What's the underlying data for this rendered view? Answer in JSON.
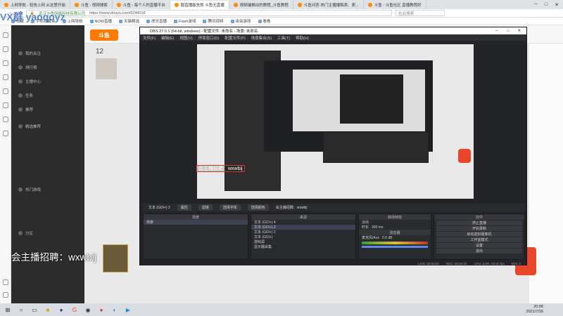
{
  "browser": {
    "tabs": [
      {
        "label": "上网导航 - 轻快上网 从这里开始"
      },
      {
        "label": "斗鱼 - 视频搜索"
      },
      {
        "label": "斗鱼 - 每个人的直播平台"
      },
      {
        "label": "服直播能失败 斗鱼无直播"
      },
      {
        "label": "视频端推出的教程_斗鱼教程"
      },
      {
        "label": "斗鱼问答-热门主播播稿类、更..."
      },
      {
        "label": "斗鱼 - 斗鱼社区 直播教程好"
      }
    ],
    "company": "武汉斗鱼网络科技有限公司",
    "url": "https://www.douyu.com/5244018",
    "search_placeholder": "在此搜索",
    "bookmarks": [
      "收藏",
      "手机收藏夹",
      "上网导航",
      "NOW直播",
      "天猫精选",
      "虎牙直播",
      "Flash游戏",
      "腾讯视频",
      "虫虫游戏",
      "看看"
    ]
  },
  "douyu": {
    "logo": "斗鱼",
    "rank": "12",
    "left_nav": [
      "我的关注",
      "排行榜",
      "主播中心",
      "任务",
      "推荐",
      "精选推荐",
      "热门游戏",
      "分区"
    ]
  },
  "obs": {
    "title": "OBS 27.0.1 (64-bit, windows) - 配置文件: 未命名 - 场景: 未命名",
    "menu": [
      "文件(F)",
      "编辑(E)",
      "视图(V)",
      "停靠窗口(D)",
      "配置文件(P)",
      "场景集合(S)",
      "工具(T)",
      "帮助(H)"
    ],
    "toolbar": {
      "source_name": "文本 (GDI+) 3",
      "props": "属性",
      "filters": "滤镜",
      "font": "选择字体",
      "text_label": "选择颜色",
      "caption": "会主播招聘：wxwbij"
    },
    "docks": {
      "scenes": {
        "title": "场景",
        "items": [
          "场景"
        ]
      },
      "sources": {
        "title": "来源",
        "items": [
          "文本 (GDI+) 4",
          "文本 (GDI+) 3",
          "文本 (GDI+) 2",
          "文本 (GDI+)",
          "游戏源",
          "显示器采集"
        ]
      },
      "transitions": {
        "title": "转场特效",
        "type": "淡出",
        "duration_label": "时长",
        "duration": "300 ms"
      },
      "mixer": {
        "title": "混音器",
        "track": "麦克风/Aux",
        "db": "0.0 dB"
      },
      "controls": {
        "title": "控件",
        "buttons": [
          "停止直播",
          "开始录制",
          "启动虚拟摄像机",
          "工作室模式",
          "设置",
          "退出"
        ]
      }
    },
    "status": {
      "live": "LIVE: 00:00:00",
      "rec": "REC: 00:00:00",
      "cpu": "CPU: 3.9%, 60.00 fps",
      "kbps": "kb/s: 0"
    }
  },
  "overlay": {
    "watermark": "VX群 yaoqoyz",
    "caption": "会主播招聘：wxwbij",
    "preview_caption": "会主播招聘：wxwbij"
  },
  "taskbar": {
    "time": "20:06",
    "date": "2021/7/26"
  }
}
